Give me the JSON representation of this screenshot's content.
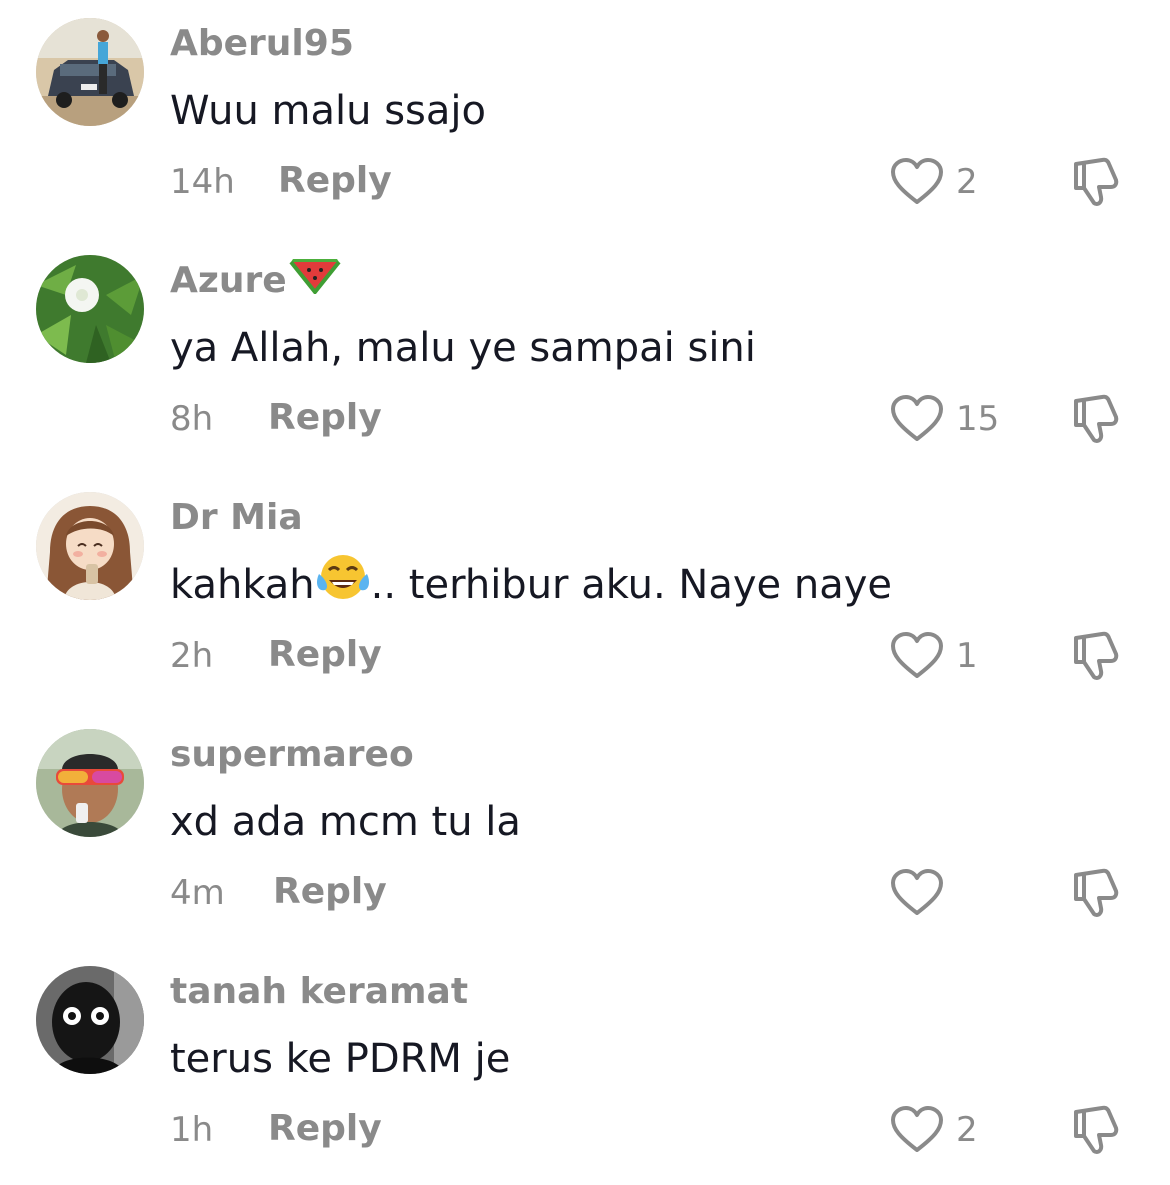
{
  "comments": [
    {
      "username": "Aberul95",
      "username_emoji": "",
      "text": "Wuu malu ssajo",
      "text_pre": "",
      "text_emoji": "",
      "text_post": "",
      "time": "14h",
      "reply_label": "Reply",
      "likes": "2"
    },
    {
      "username": "Azure",
      "username_emoji": "watermelon-icon",
      "text": "ya Allah, malu ye sampai sini",
      "text_pre": "",
      "text_emoji": "",
      "text_post": "",
      "time": "8h",
      "reply_label": "Reply",
      "likes": "15"
    },
    {
      "username": "Dr Mia",
      "username_emoji": "",
      "text": "",
      "text_pre": "kahkah",
      "text_emoji": "tears-of-joy-icon",
      "text_post": ".. terhibur aku. Naye naye",
      "time": "2h",
      "reply_label": "Reply",
      "likes": "1"
    },
    {
      "username": "supermareo",
      "username_emoji": "",
      "text": "xd ada mcm tu la",
      "text_pre": "",
      "text_emoji": "",
      "text_post": "",
      "time": "4m",
      "reply_label": "Reply",
      "likes": ""
    },
    {
      "username": "tanah keramat",
      "username_emoji": "",
      "text": "terus ke PDRM je",
      "text_pre": "",
      "text_emoji": "",
      "text_post": "",
      "time": "1h",
      "reply_label": "Reply",
      "likes": "2"
    }
  ],
  "colors": {
    "username": "#8a8a8a",
    "text": "#161823",
    "meta": "#8a8a8a",
    "background": "#ffffff"
  }
}
